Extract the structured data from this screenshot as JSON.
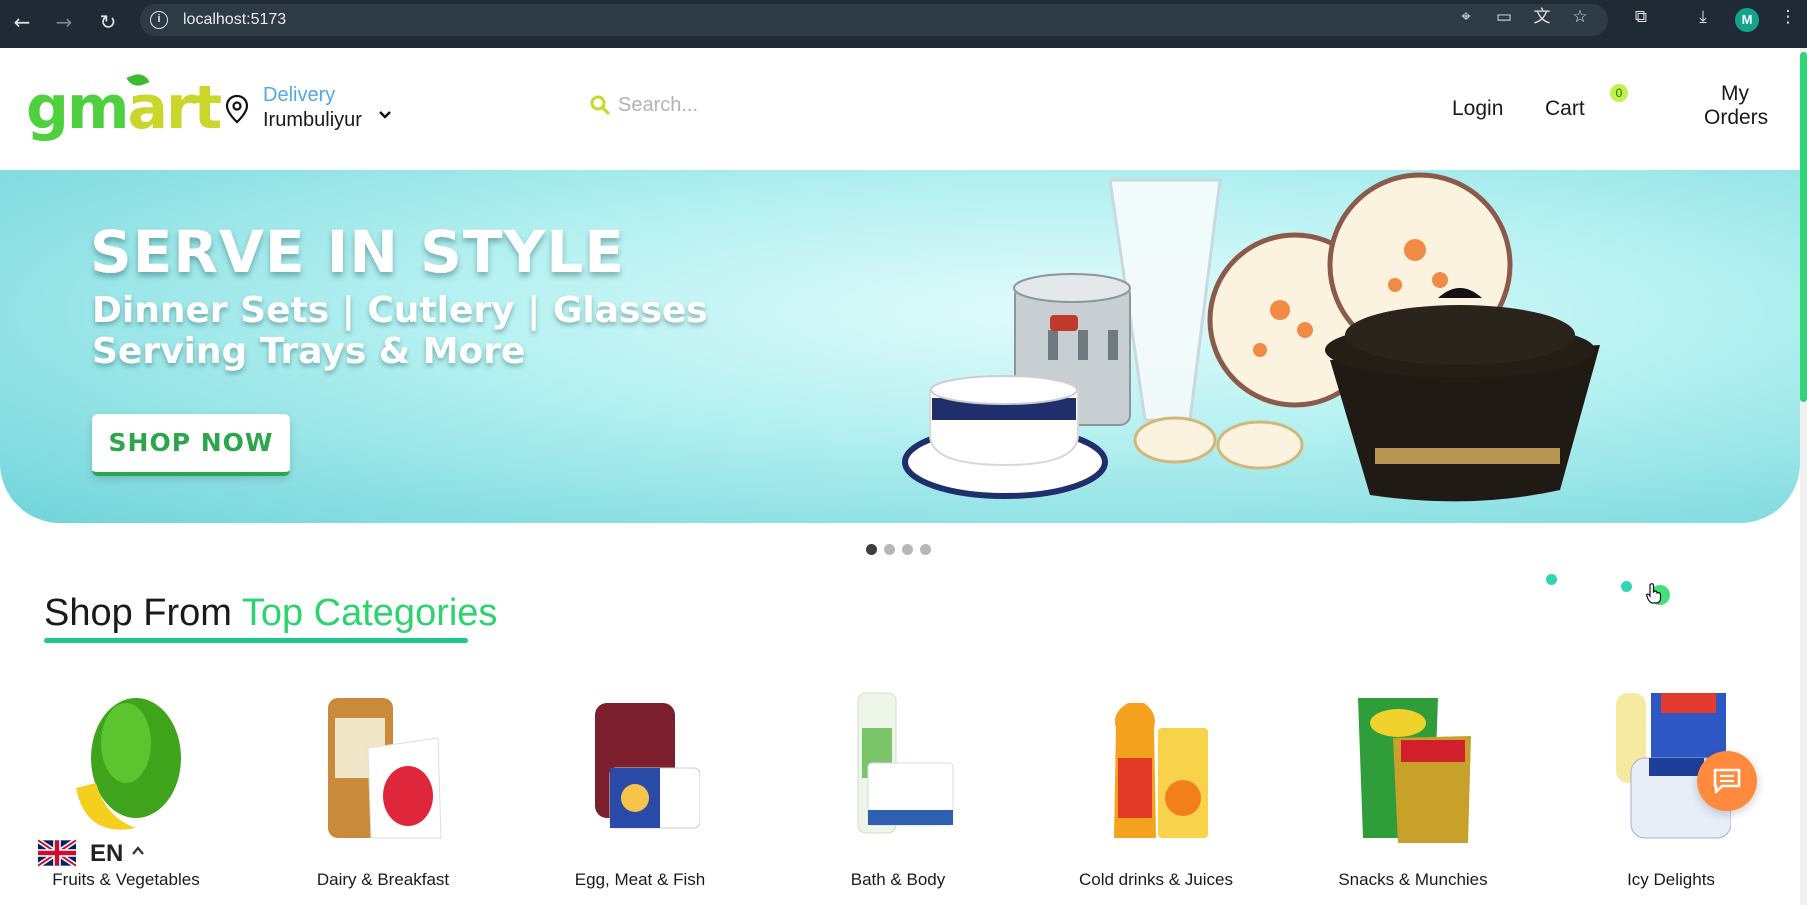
{
  "browser": {
    "url": "localhost:5173",
    "profile_initial": "M"
  },
  "header": {
    "logo_g": "gm",
    "logo_rest": "art",
    "delivery_label": "Delivery",
    "delivery_location": "Irumbuliyur",
    "search_placeholder": "Search...",
    "login": "Login",
    "cart": "Cart",
    "cart_count": "0",
    "my_orders_line1": "My",
    "my_orders_line2": "Orders"
  },
  "banner": {
    "title": "SERVE IN STYLE",
    "subtitle_line1": "Dinner Sets | Cutlery | Glasses",
    "subtitle_line2": "Serving Trays & More",
    "cta": "SHOP NOW",
    "slide_count": 4,
    "active_slide": 1
  },
  "section": {
    "title_plain": "Shop From ",
    "title_accent": "Top Categories"
  },
  "categories": [
    {
      "label": "Fruits & Vegetables"
    },
    {
      "label": "Dairy & Breakfast"
    },
    {
      "label": "Egg, Meat & Fish"
    },
    {
      "label": "Bath & Body"
    },
    {
      "label": "Cold drinks & Juices"
    },
    {
      "label": "Snacks & Munchies"
    },
    {
      "label": "Icy Delights"
    }
  ],
  "language": {
    "code": "EN"
  },
  "colors": {
    "brand_green": "#2dd36f",
    "logo_yellow": "#c8d72a",
    "delivery_blue": "#52a9e6",
    "banner_teal": "#6fd4da",
    "chat_orange": "#ff8a3d"
  }
}
